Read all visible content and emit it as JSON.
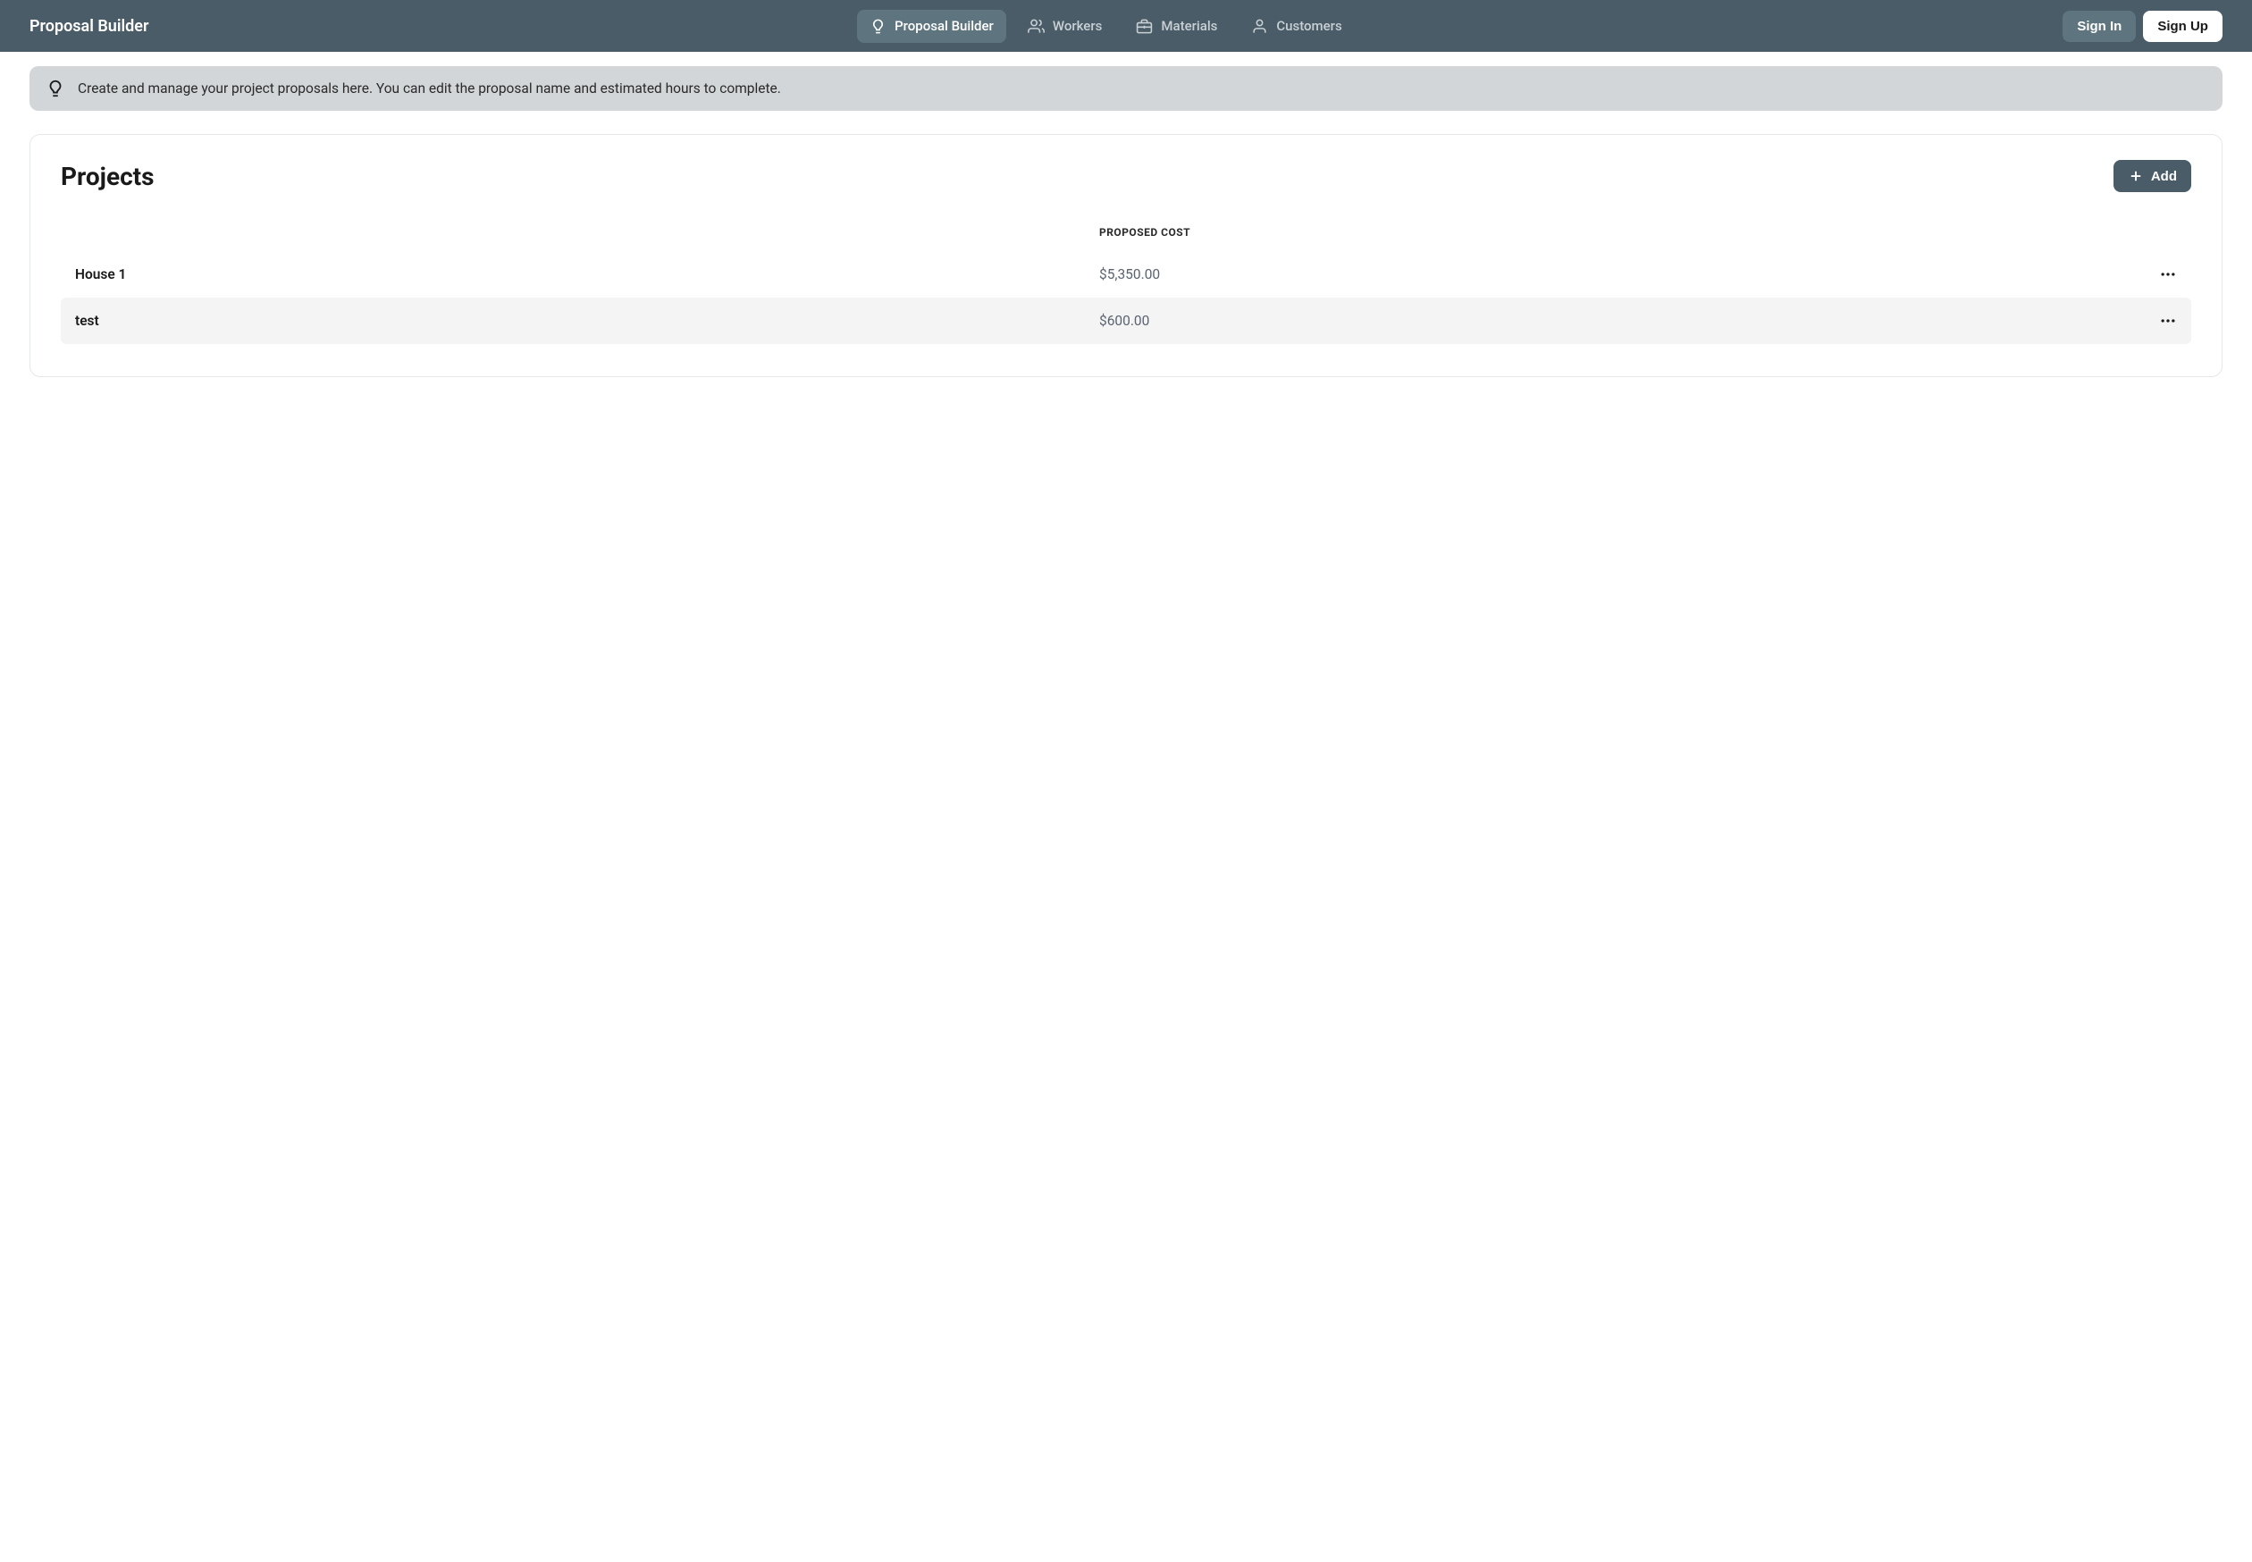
{
  "header": {
    "title": "Proposal Builder",
    "nav": [
      {
        "label": "Proposal Builder",
        "icon": "lightbulb",
        "active": true
      },
      {
        "label": "Workers",
        "icon": "users",
        "active": false
      },
      {
        "label": "Materials",
        "icon": "briefcase",
        "active": false
      },
      {
        "label": "Customers",
        "icon": "user",
        "active": false
      }
    ],
    "signin_label": "Sign In",
    "signup_label": "Sign Up"
  },
  "banner": {
    "text": "Create and manage your project proposals here. You can edit the proposal name and estimated hours to complete."
  },
  "card": {
    "title": "Projects",
    "add_label": "Add",
    "columns": {
      "name": "",
      "cost": "PROPOSED COST",
      "actions": ""
    },
    "rows": [
      {
        "name": "House 1",
        "cost": "$5,350.00"
      },
      {
        "name": "test",
        "cost": "$600.00"
      }
    ]
  }
}
